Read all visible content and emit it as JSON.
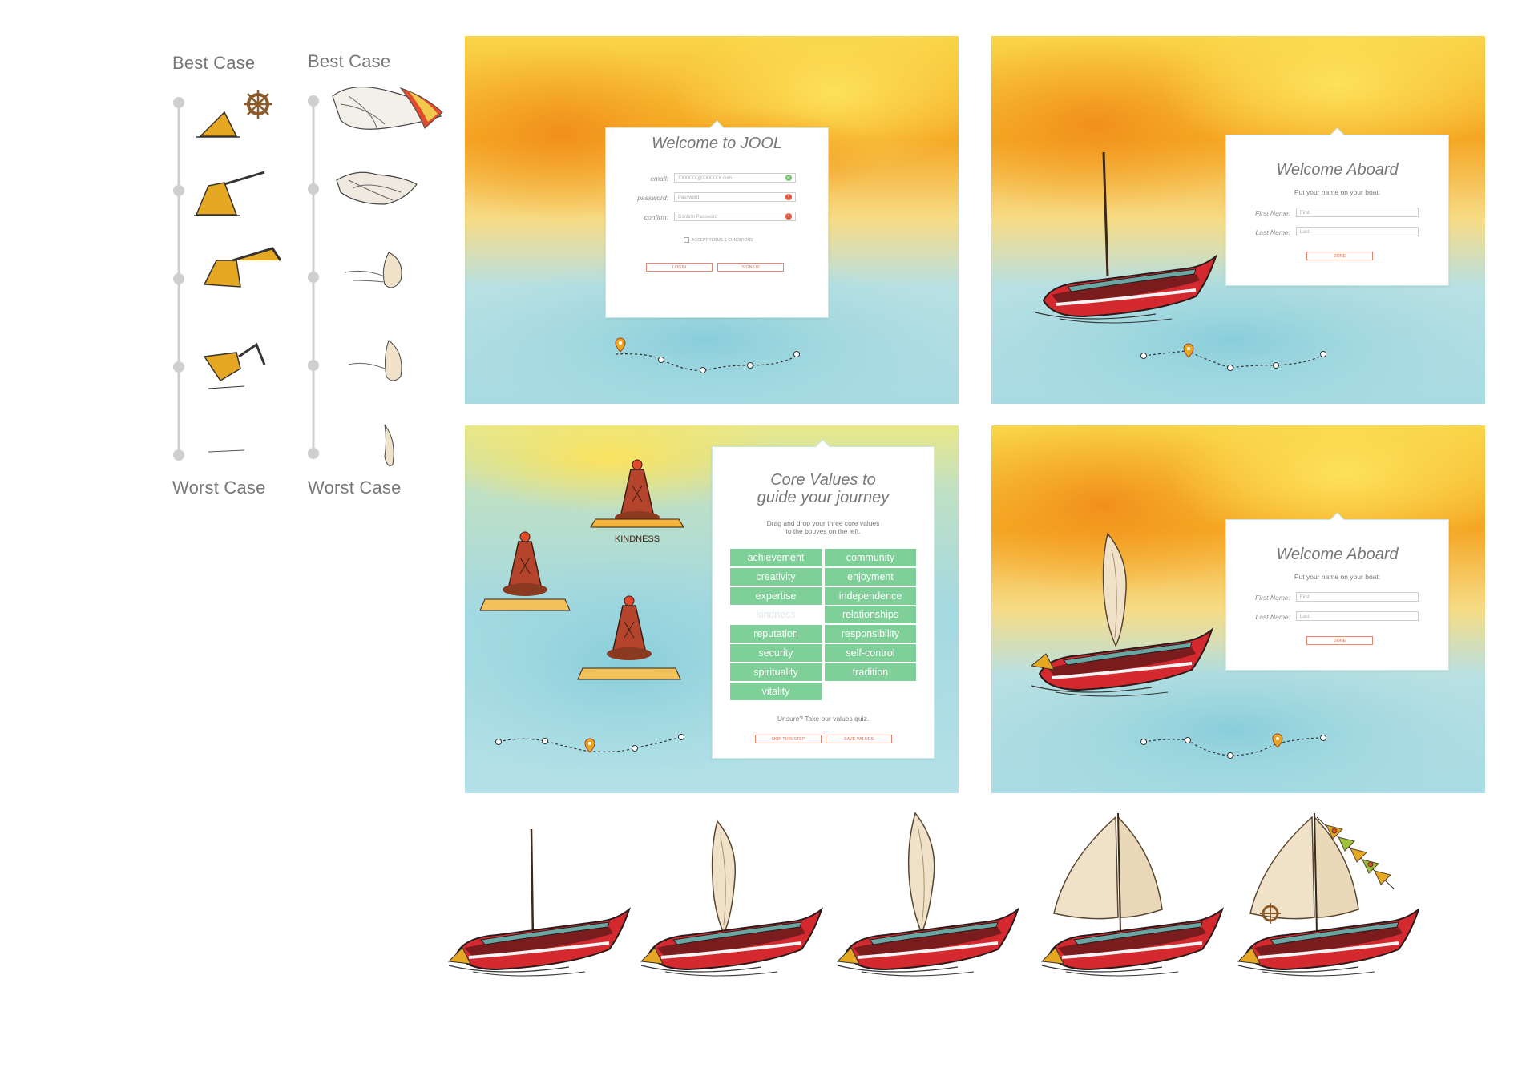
{
  "scales": {
    "left": {
      "top_label": "Best Case",
      "bottom_label": "Worst Case",
      "icons": [
        "helm-boat-stage-1-icon",
        "boat-stage-2-icon",
        "boat-stage-3-icon",
        "boat-stage-4-icon",
        "boat-stage-5-icon"
      ]
    },
    "right": {
      "top_label": "Best Case",
      "bottom_label": "Worst Case",
      "icons": [
        "sail-stage-1-icon",
        "sail-stage-2-icon",
        "sail-stage-3-icon",
        "sail-stage-4-icon",
        "sail-stage-5-icon"
      ]
    }
  },
  "screens": {
    "login": {
      "title": "Welcome to JOOL",
      "email_label": "email:",
      "email_value": "XXXXXX@XXXXXX.com",
      "password_label": "password:",
      "password_placeholder": "Password",
      "confirm_label": "confirm:",
      "confirm_placeholder": "Confirm Password",
      "terms_label": "ACCEPT TERMS & CONDITIONS",
      "login_button": "LOGIN",
      "signup_button": "SIGN UP",
      "email_status_color": "#7cc576",
      "error_status_color": "#e2583e",
      "progress_step": 1
    },
    "aboard_1": {
      "title": "Welcome Aboard",
      "subtitle": "Put your name on your boat:",
      "first_label": "First Name:",
      "first_placeholder": "First",
      "last_label": "Last Name:",
      "last_placeholder": "Last",
      "done_button": "DONE",
      "progress_step": 2
    },
    "values": {
      "title_line1": "Core Values to",
      "title_line2": "guide your journey",
      "subtitle_line1": "Drag and drop your three core values",
      "subtitle_line2": "to the bouyes on the left.",
      "buoy_label": "KINDNESS",
      "values": [
        "achievement",
        "community",
        "creativity",
        "enjoyment",
        "expertise",
        "independence",
        "kindness",
        "relationships",
        "reputation",
        "responsibility",
        "security",
        "self-control",
        "spirituality",
        "tradition",
        "vitality"
      ],
      "used_values": [
        "kindness"
      ],
      "quiz_text": "Unsure? Take our values quiz.",
      "skip_button": "SKIP THIS STEP",
      "save_button": "SAVE VALUES",
      "value_color": "#7ecf98",
      "progress_step": 3
    },
    "aboard_2": {
      "title": "Welcome Aboard",
      "subtitle": "Put your name on your boat:",
      "first_label": "First Name:",
      "first_placeholder": "First",
      "last_label": "Last Name:",
      "last_placeholder": "Last",
      "done_button": "DONE",
      "progress_step": 4
    }
  },
  "boat_stages": [
    "boat-mast-only-icon",
    "boat-small-sail-icon",
    "boat-small-sail-2-icon",
    "boat-full-sails-icon",
    "boat-full-sails-flags-icon"
  ],
  "colors": {
    "hull_red": "#d42a2f",
    "sail_cream": "#efe2c8",
    "mustard": "#e6a722",
    "watercolor_orange": "#f5a623",
    "watercolor_teal": "#9fd8e0"
  }
}
